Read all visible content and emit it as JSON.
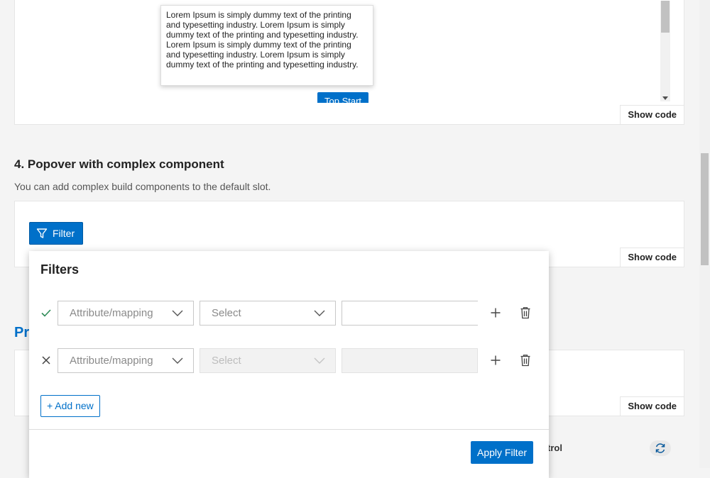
{
  "demo3": {
    "popover_text": "Lorem Ipsum is simply dummy text of the printing and typesetting industry. Lorem Ipsum is simply dummy text of the printing and typesetting industry. Lorem Ipsum is simply dummy text of the printing and typesetting industry. Lorem Ipsum is simply dummy text of the printing and typesetting industry.",
    "trigger_label": "Top Start",
    "show_code": "Show code"
  },
  "demo4": {
    "heading": "4. Popover with complex component",
    "description": "You can add complex build components to the default slot.",
    "filter_button": "Filter",
    "show_code": "Show code"
  },
  "demo5": {
    "heading_partial": "Pr",
    "show_code": "Show code"
  },
  "demo6": {
    "label_partial": "trol"
  },
  "filters_popover": {
    "title": "Filters",
    "rows": [
      {
        "status": "valid",
        "status_icon": "check-icon",
        "attribute_placeholder": "Attribute/mapping",
        "operator_placeholder": "Select",
        "operator_disabled": false,
        "value": "",
        "value_disabled": false
      },
      {
        "status": "invalid",
        "status_icon": "close-icon",
        "attribute_placeholder": "Attribute/mapping",
        "operator_placeholder": "Select",
        "operator_disabled": true,
        "value": "",
        "value_disabled": true
      }
    ],
    "add_new_label": "+ Add new",
    "apply_label": "Apply Filter"
  },
  "colors": {
    "accent": "#0070c9",
    "valid": "#2e8b57",
    "background": "#f4f4f4"
  }
}
